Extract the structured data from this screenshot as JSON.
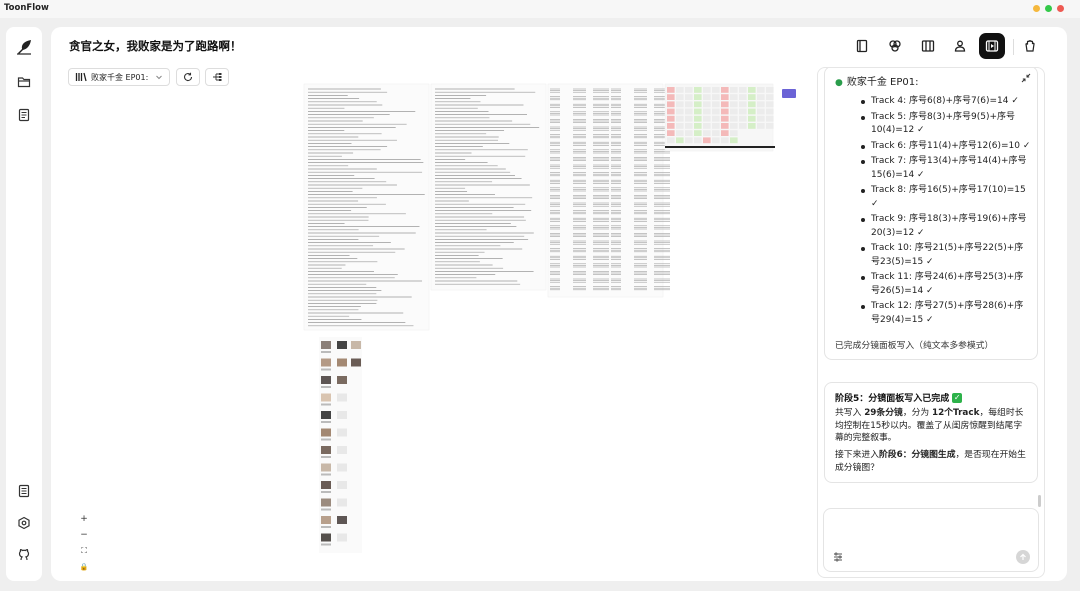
{
  "app": {
    "name": "ToonFlow"
  },
  "window": {
    "controls": [
      "minimize",
      "zoom",
      "close"
    ],
    "colors": [
      "#f5b83d",
      "#34c94a",
      "#ee5a52"
    ]
  },
  "sidebar": {
    "top": [
      "quill-icon",
      "folder-icon",
      "document-icon"
    ],
    "bottom": [
      "notes-icon",
      "settings-icon",
      "github-icon"
    ]
  },
  "header": {
    "title": "贪官之女，我败家是为了跑路啊！",
    "tools": [
      "script-icon",
      "assets-icon",
      "storyboard-icon",
      "characters-icon",
      "video-icon",
      "gloves-icon"
    ],
    "active_tool": "video-icon"
  },
  "canvas": {
    "episode": "败家千金 EP01:",
    "zoom_controls": [
      "+",
      "−",
      "⛶",
      "🔒"
    ]
  },
  "chat": {
    "card1": {
      "title": "败家千金 EP01:",
      "tracks": [
        "Track 4: 序号6(8)+序号7(6)=14 ✓",
        "Track 5: 序号8(3)+序号9(5)+序号10(4)=12 ✓",
        "Track 6: 序号11(4)+序号12(6)=10 ✓",
        "Track 7: 序号13(4)+序号14(4)+序号15(6)=14 ✓",
        "Track 8: 序号16(5)+序号17(10)=15 ✓",
        "Track 9: 序号18(3)+序号19(6)+序号20(3)=12 ✓",
        "Track 10: 序号21(5)+序号22(5)+序号23(5)=15 ✓",
        "Track 11: 序号24(6)+序号25(3)+序号26(5)=14 ✓",
        "Track 12: 序号27(5)+序号28(6)+序号29(4)=15 ✓"
      ],
      "footer": "已完成分镜面板写入（纯文本多参模式）"
    },
    "card2": {
      "heading": "阶段5：分镜面板写入已完成",
      "p1_a": "共写入 ",
      "p1_b": "29条分镜",
      "p1_c": "，分为 ",
      "p1_d": "12个Track",
      "p1_e": "，每组时长均控制在15秒以内。覆盖了从闺房惊醒到结尾字幕的完整叙事。",
      "p2_a": "接下来进入",
      "p2_b": "阶段6：分镜图生成",
      "p2_c": "，是否现在开始生成分镜图？"
    }
  }
}
